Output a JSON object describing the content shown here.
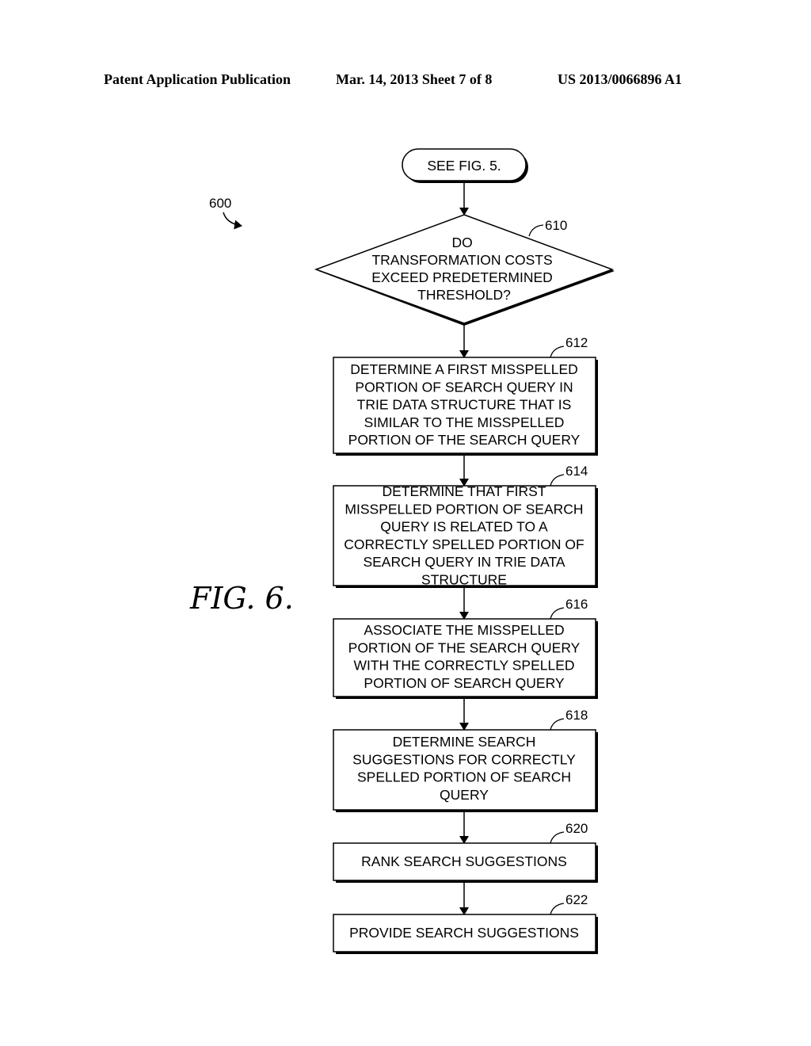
{
  "header": {
    "publication": "Patent Application Publication",
    "date_sheet": "Mar. 14, 2013  Sheet 7 of 8",
    "patent_number": "US 2013/0066896 A1"
  },
  "figure": {
    "label": "FIG. 6.",
    "ref": "600"
  },
  "start": {
    "text": "SEE FIG. 5."
  },
  "decision": {
    "ref": "610",
    "lines": [
      "DO",
      "TRANSFORMATION COSTS",
      "EXCEED PREDETERMINED",
      "THRESHOLD?"
    ]
  },
  "steps": [
    {
      "ref": "612",
      "lines": [
        "DETERMINE A FIRST MISSPELLED",
        "PORTION OF SEARCH QUERY IN",
        "TRIE DATA STRUCTURE THAT IS",
        "SIMILAR TO THE MISSPELLED",
        "PORTION OF THE SEARCH QUERY"
      ]
    },
    {
      "ref": "614",
      "lines": [
        "DETERMINE THAT FIRST",
        "MISSPELLED PORTION OF SEARCH",
        "QUERY IS RELATED TO A",
        "CORRECTLY SPELLED PORTION OF",
        "SEARCH QUERY IN TRIE DATA",
        "STRUCTURE"
      ]
    },
    {
      "ref": "616",
      "lines": [
        "ASSOCIATE THE MISSPELLED",
        "PORTION OF THE SEARCH QUERY",
        "WITH THE CORRECTLY SPELLED",
        "PORTION OF SEARCH QUERY"
      ]
    },
    {
      "ref": "618",
      "lines": [
        "DETERMINE SEARCH",
        "SUGGESTIONS FOR CORRECTLY",
        "SPELLED PORTION OF SEARCH",
        "QUERY"
      ]
    },
    {
      "ref": "620",
      "lines": [
        "RANK SEARCH SUGGESTIONS"
      ]
    },
    {
      "ref": "622",
      "lines": [
        "PROVIDE SEARCH SUGGESTIONS"
      ]
    }
  ]
}
